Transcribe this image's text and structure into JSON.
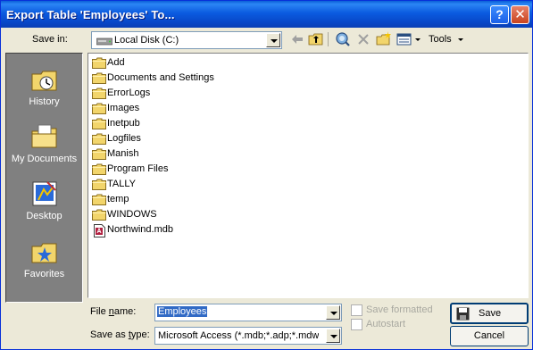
{
  "window": {
    "title": "Export Table 'Employees' To...",
    "help_glyph": "?",
    "close_glyph": "✕"
  },
  "toolbar": {
    "save_in_label": "Save in:",
    "save_in_value": "Local Disk (C:)",
    "tools_label": "Tools"
  },
  "places": [
    {
      "label": "History",
      "icon": "history-icon"
    },
    {
      "label": "My Documents",
      "icon": "my-documents-icon"
    },
    {
      "label": "Desktop",
      "icon": "desktop-icon"
    },
    {
      "label": "Favorites",
      "icon": "favorites-icon"
    }
  ],
  "files": [
    {
      "name": "Add",
      "type": "folder"
    },
    {
      "name": "Documents and Settings",
      "type": "folder"
    },
    {
      "name": "ErrorLogs",
      "type": "folder"
    },
    {
      "name": "Images",
      "type": "folder"
    },
    {
      "name": "Inetpub",
      "type": "folder"
    },
    {
      "name": "Logfiles",
      "type": "folder"
    },
    {
      "name": "Manish",
      "type": "folder"
    },
    {
      "name": "Program Files",
      "type": "folder"
    },
    {
      "name": "TALLY",
      "type": "folder"
    },
    {
      "name": "temp",
      "type": "folder"
    },
    {
      "name": "WINDOWS",
      "type": "folder"
    },
    {
      "name": "Northwind.mdb",
      "type": "access-database"
    }
  ],
  "bottom": {
    "file_name_label": "File name:",
    "file_name_value": "Employees",
    "save_as_type_label": "Save as type:",
    "save_as_type_value": "Microsoft Access (*.mdb;*.adp;*.mdw;",
    "save_formatted_label": "Save formatted",
    "autostart_label": "Autostart",
    "save_button": "Save",
    "cancel_button": "Cancel"
  },
  "colors": {
    "titlebar": "#0A5FD8",
    "dialog_bg": "#ECE9D8",
    "places_bg": "#808080",
    "selection": "#316AC5",
    "folder": "#F2D56B"
  }
}
